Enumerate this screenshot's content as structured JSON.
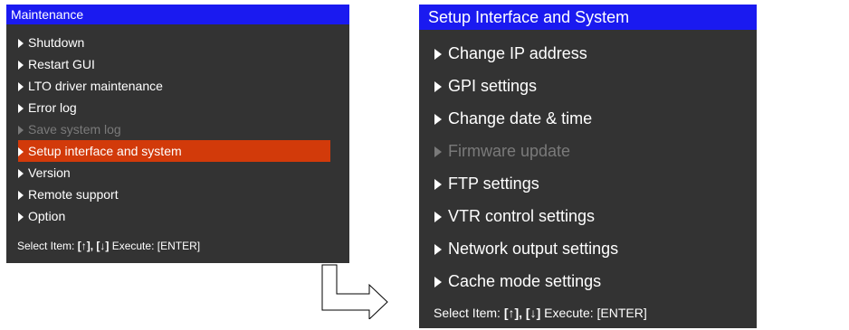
{
  "left_menu": {
    "title": "Maintenance",
    "items": [
      {
        "label": "Shutdown",
        "state": "normal"
      },
      {
        "label": "Restart GUI",
        "state": "normal"
      },
      {
        "label": "LTO driver maintenance",
        "state": "normal"
      },
      {
        "label": "Error log",
        "state": "normal"
      },
      {
        "label": "Save system log",
        "state": "disabled"
      },
      {
        "label": "Setup interface and system",
        "state": "selected"
      },
      {
        "label": "Version",
        "state": "normal"
      },
      {
        "label": "Remote support",
        "state": "normal"
      },
      {
        "label": "Option",
        "state": "normal"
      }
    ],
    "footer": {
      "select_label": "Select Item:",
      "keys": "[↑], [↓]",
      "execute_label": "Execute: [ENTER]"
    }
  },
  "right_menu": {
    "title": "Setup Interface and System",
    "items": [
      {
        "label": "Change IP address",
        "state": "normal"
      },
      {
        "label": "GPI settings",
        "state": "normal"
      },
      {
        "label": "Change date & time",
        "state": "normal"
      },
      {
        "label": "Firmware update",
        "state": "disabled"
      },
      {
        "label": "FTP settings",
        "state": "normal"
      },
      {
        "label": "VTR control settings",
        "state": "normal"
      },
      {
        "label": "Network output settings",
        "state": "normal"
      },
      {
        "label": "Cache mode settings",
        "state": "normal"
      }
    ],
    "footer": {
      "select_label": "Select Item:",
      "keys": "[↑], [↓]",
      "execute_label": "Execute: [ENTER]"
    }
  },
  "colors": {
    "title_bar": "#1a1af0",
    "panel_bg": "#333333",
    "selected_bg": "#d23a0a",
    "disabled_text": "#7a7a7a"
  },
  "icons": {
    "item_marker": "triangle-right-icon",
    "connector": "arrow-down-right-icon"
  }
}
